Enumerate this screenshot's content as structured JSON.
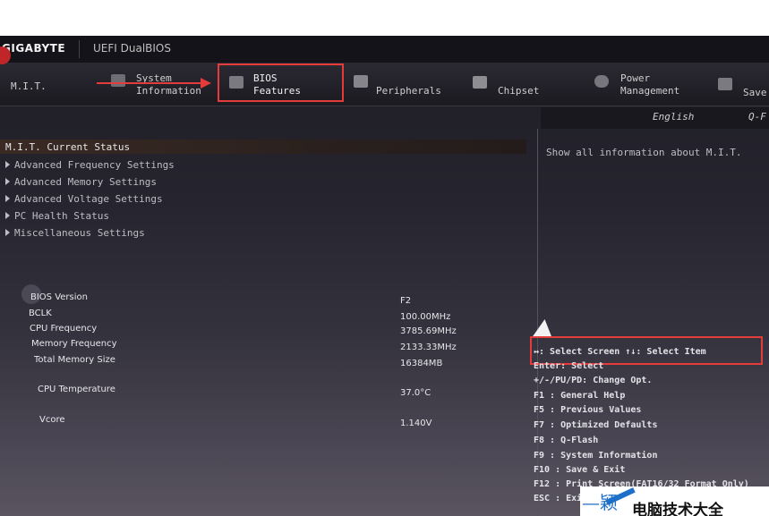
{
  "header": {
    "brand": "GIGABYTE",
    "product": "UEFI DualBIOS"
  },
  "tabs": [
    {
      "line1": "M.I.T.",
      "line2": ""
    },
    {
      "line1": "System",
      "line2": "Information"
    },
    {
      "line1": "BIOS",
      "line2": "Features"
    },
    {
      "line1": "Peripherals",
      "line2": ""
    },
    {
      "line1": "Chipset",
      "line2": ""
    },
    {
      "line1": "Power",
      "line2": "Management"
    },
    {
      "line1": "Save",
      "line2": ""
    }
  ],
  "langbar": {
    "language": "English",
    "qflash": "Q-F"
  },
  "menu": [
    "M.I.T. Current Status",
    "Advanced Frequency Settings",
    "Advanced Memory Settings",
    "Advanced Voltage Settings",
    "PC Health Status",
    "Miscellaneous Settings"
  ],
  "help_text": "Show all information about M.I.T.",
  "info": [
    {
      "label": "BIOS Version",
      "value": "F2"
    },
    {
      "label": "BCLK",
      "value": "100.00MHz"
    },
    {
      "label": "CPU Frequency",
      "value": "3785.69MHz"
    },
    {
      "label": "Memory Frequency",
      "value": "2133.33MHz"
    },
    {
      "label": "Total Memory Size",
      "value": "16384MB"
    },
    {
      "label": "CPU Temperature",
      "value": "37.0°C"
    },
    {
      "label": "Vcore",
      "value": "1.140V"
    }
  ],
  "keys": [
    "↔: Select Screen  ↑↓: Select Item",
    "Enter: Select",
    "+/-/PU/PD: Change Opt.",
    "F1  : General Help",
    "F5  : Previous Values",
    "F7  : Optimized Defaults",
    "F8  : Q-Flash",
    "F9  : System Information",
    "F10 : Save & Exit",
    "F12 : Print Screen(FAT16/32 Format Only)",
    "ESC : Exit"
  ],
  "watermark": {
    "part1": "—颖",
    "part2": "电脑技术大全"
  },
  "colors": {
    "highlight": "#e53b3b",
    "accent_red": "#c0252a",
    "watermark_blue": "#1d6fc9"
  }
}
